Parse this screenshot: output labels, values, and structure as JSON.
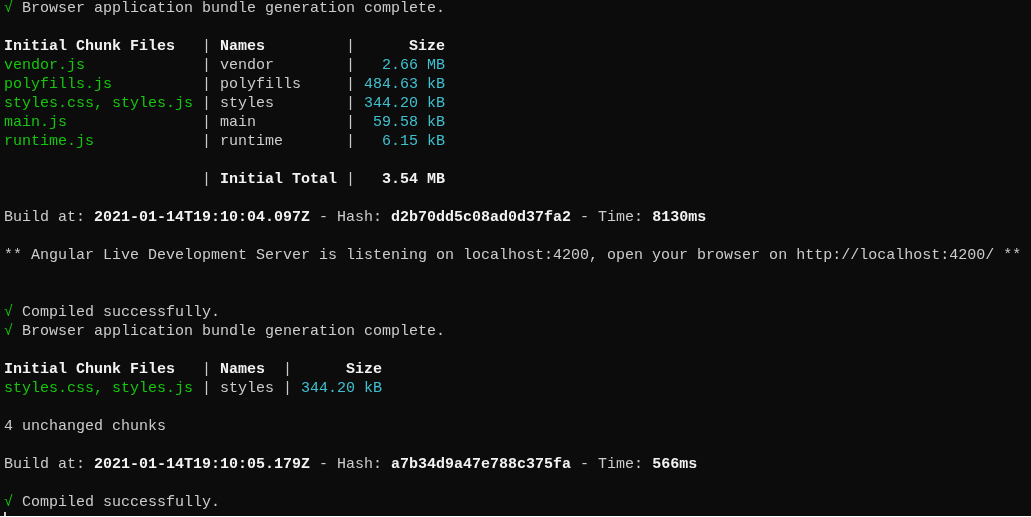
{
  "terminal": {
    "lines": [
      {
        "kind": "text",
        "segments": [
          {
            "kind": "check",
            "text": "√"
          },
          {
            "kind": "plain",
            "text": " Browser application bundle generation complete."
          }
        ]
      },
      {
        "kind": "blank"
      },
      {
        "kind": "text",
        "segments": [
          {
            "kind": "bold",
            "text": "Initial Chunk Files   "
          },
          {
            "kind": "plain",
            "text": "| "
          },
          {
            "kind": "bold",
            "text": "Names        "
          },
          {
            "kind": "plain",
            "text": " | "
          },
          {
            "kind": "bold",
            "text": "     Size"
          }
        ]
      },
      {
        "kind": "text",
        "segments": [
          {
            "kind": "green",
            "text": "vendor.js             "
          },
          {
            "kind": "plain",
            "text": "| vendor        | "
          },
          {
            "kind": "cyan",
            "text": "  2.66 MB"
          }
        ]
      },
      {
        "kind": "text",
        "segments": [
          {
            "kind": "green",
            "text": "polyfills.js          "
          },
          {
            "kind": "plain",
            "text": "| polyfills     | "
          },
          {
            "kind": "cyan",
            "text": "484.63 kB"
          }
        ]
      },
      {
        "kind": "text",
        "segments": [
          {
            "kind": "green",
            "text": "styles.css, styles.js "
          },
          {
            "kind": "plain",
            "text": "| styles        | "
          },
          {
            "kind": "cyan",
            "text": "344.20 kB"
          }
        ]
      },
      {
        "kind": "text",
        "segments": [
          {
            "kind": "green",
            "text": "main.js               "
          },
          {
            "kind": "plain",
            "text": "| main          | "
          },
          {
            "kind": "cyan",
            "text": " 59.58 kB"
          }
        ]
      },
      {
        "kind": "text",
        "segments": [
          {
            "kind": "green",
            "text": "runtime.js            "
          },
          {
            "kind": "plain",
            "text": "| runtime       | "
          },
          {
            "kind": "cyan",
            "text": "  6.15 kB"
          }
        ]
      },
      {
        "kind": "blank"
      },
      {
        "kind": "text",
        "segments": [
          {
            "kind": "plain",
            "text": "                      | "
          },
          {
            "kind": "bold",
            "text": "Initial Total"
          },
          {
            "kind": "plain",
            "text": " | "
          },
          {
            "kind": "bold",
            "text": "  3.54 MB"
          }
        ]
      },
      {
        "kind": "blank"
      },
      {
        "kind": "text",
        "segments": [
          {
            "kind": "plain",
            "text": "Build at: "
          },
          {
            "kind": "bold",
            "text": "2021-01-14T19:10:04.097Z"
          },
          {
            "kind": "plain",
            "text": " - Hash: "
          },
          {
            "kind": "bold",
            "text": "d2b70dd5c08ad0d37fa2"
          },
          {
            "kind": "plain",
            "text": " - Time: "
          },
          {
            "kind": "bold",
            "text": "8130ms"
          }
        ]
      },
      {
        "kind": "blank"
      },
      {
        "kind": "text",
        "segments": [
          {
            "kind": "plain",
            "text": "** Angular Live Development Server is listening on localhost:4200, open your browser on http://localhost:4200/ **"
          }
        ]
      },
      {
        "kind": "blank"
      },
      {
        "kind": "blank"
      },
      {
        "kind": "text",
        "segments": [
          {
            "kind": "check",
            "text": "√"
          },
          {
            "kind": "plain",
            "text": " Compiled successfully."
          }
        ]
      },
      {
        "kind": "text",
        "segments": [
          {
            "kind": "check",
            "text": "√"
          },
          {
            "kind": "plain",
            "text": " Browser application bundle generation complete."
          }
        ]
      },
      {
        "kind": "blank"
      },
      {
        "kind": "text",
        "segments": [
          {
            "kind": "bold",
            "text": "Initial Chunk Files   "
          },
          {
            "kind": "plain",
            "text": "| "
          },
          {
            "kind": "bold",
            "text": "Names "
          },
          {
            "kind": "plain",
            "text": " | "
          },
          {
            "kind": "bold",
            "text": "     Size"
          }
        ]
      },
      {
        "kind": "text",
        "segments": [
          {
            "kind": "green",
            "text": "styles.css, styles.js "
          },
          {
            "kind": "plain",
            "text": "| styles | "
          },
          {
            "kind": "cyan",
            "text": "344.20 kB"
          }
        ]
      },
      {
        "kind": "blank"
      },
      {
        "kind": "text",
        "segments": [
          {
            "kind": "plain",
            "text": "4 unchanged chunks"
          }
        ]
      },
      {
        "kind": "blank"
      },
      {
        "kind": "text",
        "segments": [
          {
            "kind": "plain",
            "text": "Build at: "
          },
          {
            "kind": "bold",
            "text": "2021-01-14T19:10:05.179Z"
          },
          {
            "kind": "plain",
            "text": " - Hash: "
          },
          {
            "kind": "bold",
            "text": "a7b34d9a47e788c375fa"
          },
          {
            "kind": "plain",
            "text": " - Time: "
          },
          {
            "kind": "bold",
            "text": "566ms"
          }
        ]
      },
      {
        "kind": "blank"
      },
      {
        "kind": "text",
        "segments": [
          {
            "kind": "check",
            "text": "√"
          },
          {
            "kind": "plain",
            "text": " Compiled successfully."
          }
        ]
      },
      {
        "kind": "cursor"
      }
    ]
  }
}
